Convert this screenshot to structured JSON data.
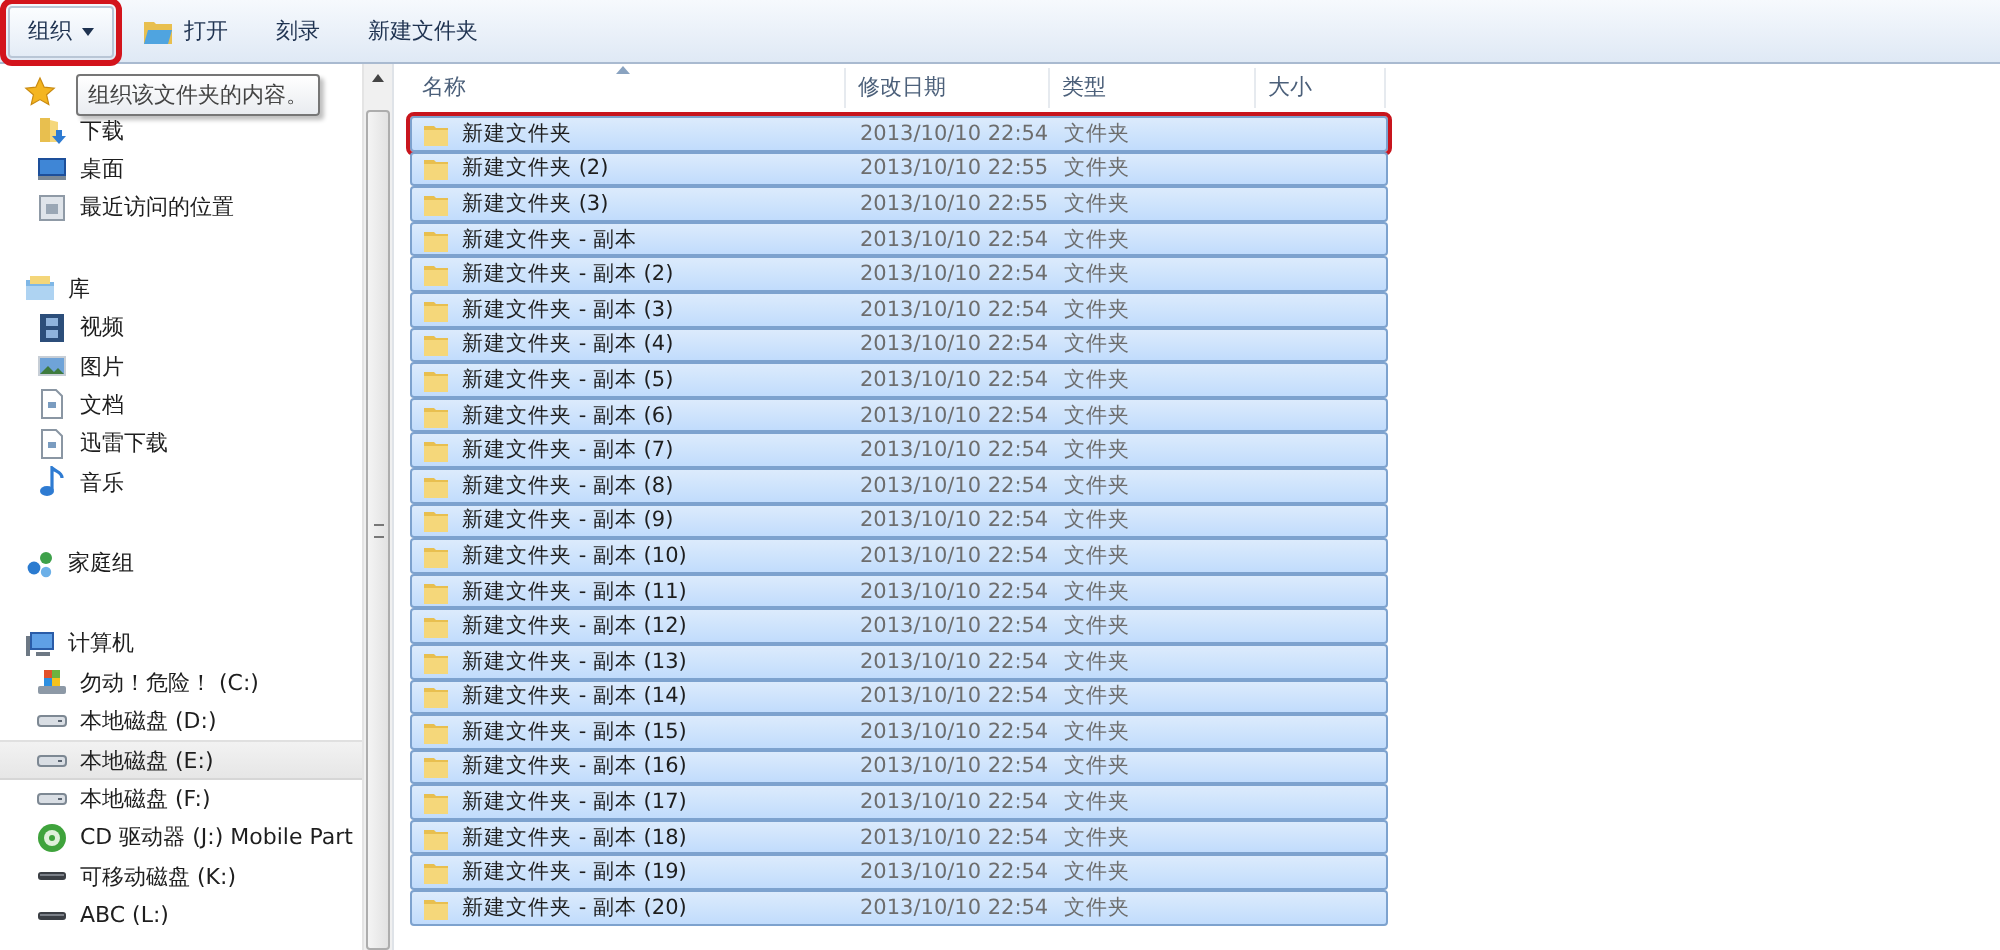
{
  "toolbar": {
    "buttons": [
      {
        "label": "组织",
        "kind": "menu",
        "outlined": true
      },
      {
        "label": "打开",
        "kind": "open",
        "outlined": false
      },
      {
        "label": "刻录",
        "kind": "plain",
        "outlined": false
      },
      {
        "label": "新建文件夹",
        "kind": "plain",
        "outlined": false
      }
    ]
  },
  "tooltip": {
    "text": "组织该文件夹的内容。"
  },
  "sidebar": {
    "groups": [
      {
        "kind": "favorites",
        "items": [
          {
            "label": "下载",
            "kind": "download",
            "selected": false
          },
          {
            "label": "桌面",
            "kind": "desktop",
            "selected": false
          },
          {
            "label": "最近访问的位置",
            "kind": "recent",
            "selected": false
          }
        ]
      },
      {
        "kind": "library",
        "label": "库",
        "items": [
          {
            "label": "视频",
            "kind": "video",
            "selected": false
          },
          {
            "label": "图片",
            "kind": "picture",
            "selected": false
          },
          {
            "label": "文档",
            "kind": "document",
            "selected": false
          },
          {
            "label": "迅雷下载",
            "kind": "document",
            "selected": false
          },
          {
            "label": "音乐",
            "kind": "music",
            "selected": false
          }
        ]
      },
      {
        "kind": "homegroup",
        "label": "家庭组"
      },
      {
        "kind": "computer",
        "label": "计算机",
        "items": [
          {
            "label": "勿动！危险！ (C:)",
            "kind": "system",
            "selected": false
          },
          {
            "label": "本地磁盘 (D:)",
            "kind": "drive",
            "selected": false
          },
          {
            "label": "本地磁盘 (E:)",
            "kind": "drive",
            "selected": true
          },
          {
            "label": "本地磁盘 (F:)",
            "kind": "drive",
            "selected": false
          },
          {
            "label": "CD 驱动器 (J:) Mobile Part",
            "kind": "cd",
            "selected": false
          },
          {
            "label": "可移动磁盘 (K:)",
            "kind": "removable",
            "selected": false
          },
          {
            "label": "ABC (L:)",
            "kind": "removable",
            "selected": false
          }
        ]
      }
    ]
  },
  "table": {
    "columns": [
      "名称",
      "修改日期",
      "类型",
      "大小"
    ],
    "rows": [
      {
        "name": "新建文件夹",
        "date": "2013/10/10 22:54",
        "type": "文件夹",
        "selected": true,
        "outlined": true
      },
      {
        "name": "新建文件夹 (2)",
        "date": "2013/10/10 22:55",
        "type": "文件夹",
        "selected": true,
        "outlined": false
      },
      {
        "name": "新建文件夹 (3)",
        "date": "2013/10/10 22:55",
        "type": "文件夹",
        "selected": true,
        "outlined": false
      },
      {
        "name": "新建文件夹 - 副本",
        "date": "2013/10/10 22:54",
        "type": "文件夹",
        "selected": true,
        "outlined": false
      },
      {
        "name": "新建文件夹 - 副本 (2)",
        "date": "2013/10/10 22:54",
        "type": "文件夹",
        "selected": true,
        "outlined": false
      },
      {
        "name": "新建文件夹 - 副本 (3)",
        "date": "2013/10/10 22:54",
        "type": "文件夹",
        "selected": true,
        "outlined": false
      },
      {
        "name": "新建文件夹 - 副本 (4)",
        "date": "2013/10/10 22:54",
        "type": "文件夹",
        "selected": true,
        "outlined": false
      },
      {
        "name": "新建文件夹 - 副本 (5)",
        "date": "2013/10/10 22:54",
        "type": "文件夹",
        "selected": true,
        "outlined": false
      },
      {
        "name": "新建文件夹 - 副本 (6)",
        "date": "2013/10/10 22:54",
        "type": "文件夹",
        "selected": true,
        "outlined": false
      },
      {
        "name": "新建文件夹 - 副本 (7)",
        "date": "2013/10/10 22:54",
        "type": "文件夹",
        "selected": true,
        "outlined": false
      },
      {
        "name": "新建文件夹 - 副本 (8)",
        "date": "2013/10/10 22:54",
        "type": "文件夹",
        "selected": true,
        "outlined": false
      },
      {
        "name": "新建文件夹 - 副本 (9)",
        "date": "2013/10/10 22:54",
        "type": "文件夹",
        "selected": true,
        "outlined": false
      },
      {
        "name": "新建文件夹 - 副本 (10)",
        "date": "2013/10/10 22:54",
        "type": "文件夹",
        "selected": true,
        "outlined": false
      },
      {
        "name": "新建文件夹 - 副本 (11)",
        "date": "2013/10/10 22:54",
        "type": "文件夹",
        "selected": true,
        "outlined": false
      },
      {
        "name": "新建文件夹 - 副本 (12)",
        "date": "2013/10/10 22:54",
        "type": "文件夹",
        "selected": true,
        "outlined": false
      },
      {
        "name": "新建文件夹 - 副本 (13)",
        "date": "2013/10/10 22:54",
        "type": "文件夹",
        "selected": true,
        "outlined": false
      },
      {
        "name": "新建文件夹 - 副本 (14)",
        "date": "2013/10/10 22:54",
        "type": "文件夹",
        "selected": true,
        "outlined": false
      },
      {
        "name": "新建文件夹 - 副本 (15)",
        "date": "2013/10/10 22:54",
        "type": "文件夹",
        "selected": true,
        "outlined": false
      },
      {
        "name": "新建文件夹 - 副本 (16)",
        "date": "2013/10/10 22:54",
        "type": "文件夹",
        "selected": true,
        "outlined": false
      },
      {
        "name": "新建文件夹 - 副本 (17)",
        "date": "2013/10/10 22:54",
        "type": "文件夹",
        "selected": true,
        "outlined": false
      },
      {
        "name": "新建文件夹 - 副本 (18)",
        "date": "2013/10/10 22:54",
        "type": "文件夹",
        "selected": true,
        "outlined": false
      },
      {
        "name": "新建文件夹 - 副本 (19)",
        "date": "2013/10/10 22:54",
        "type": "文件夹",
        "selected": true,
        "outlined": false
      },
      {
        "name": "新建文件夹 - 副本 (20)",
        "date": "2013/10/10 22:54",
        "type": "文件夹",
        "selected": true,
        "outlined": false
      }
    ]
  }
}
